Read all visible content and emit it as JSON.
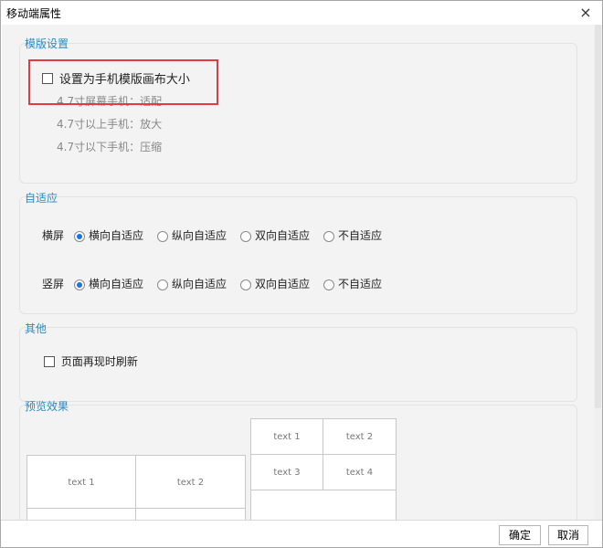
{
  "dialog": {
    "title": "移动端属性",
    "close_glyph": "×"
  },
  "template_settings": {
    "legend": "模版设置",
    "checkbox_label": "设置为手机模版画布大小",
    "hints": [
      "4.7寸屏幕手机：适配",
      "4.7寸以上手机：放大",
      "4.7寸以下手机：压缩"
    ]
  },
  "adaptive": {
    "legend": "自适应",
    "landscape_label": "横屏",
    "portrait_label": "竖屏",
    "options": [
      "横向自适应",
      "纵向自适应",
      "双向自适应",
      "不自适应"
    ],
    "landscape_selected": "横向自适应",
    "portrait_selected": "横向自适应"
  },
  "other": {
    "legend": "其他",
    "checkbox_label": "页面再现时刷新"
  },
  "preview": {
    "legend": "预览效果",
    "left_cells": [
      "text 1",
      "text 2"
    ],
    "right_cells": [
      "text 1",
      "text 2",
      "text 3",
      "text 4"
    ]
  },
  "footer": {
    "ok_label": "确定",
    "cancel_label": "取消"
  },
  "colors": {
    "accent": "#2a8ac4",
    "highlight_border": "#e23c3c",
    "radio_selected": "#1a73e8"
  }
}
